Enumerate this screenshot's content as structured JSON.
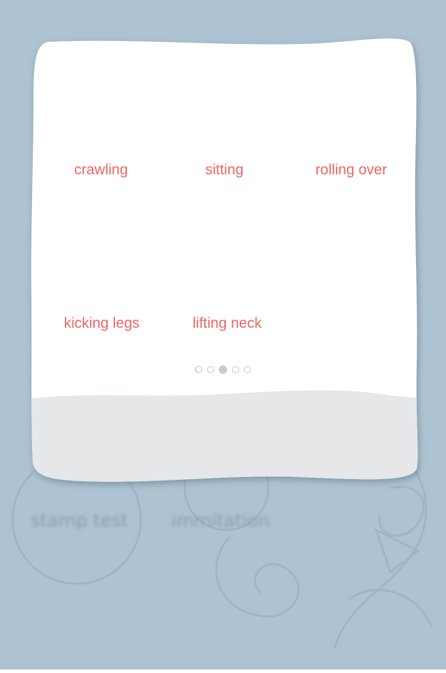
{
  "background": {
    "color": "#a9bfcf",
    "blurred_labels": [
      "stamp test",
      "immitation"
    ]
  },
  "card": {
    "fill": "#ffffff",
    "footer_fill": "#e6e7e9",
    "milestones": [
      {
        "label": "crawling"
      },
      {
        "label": "sitting"
      },
      {
        "label": "rolling over"
      },
      {
        "label": "kicking legs"
      },
      {
        "label": "lifting neck"
      }
    ],
    "label_color": "#ef6463"
  },
  "pager": {
    "count": 5,
    "active_index": 2
  }
}
